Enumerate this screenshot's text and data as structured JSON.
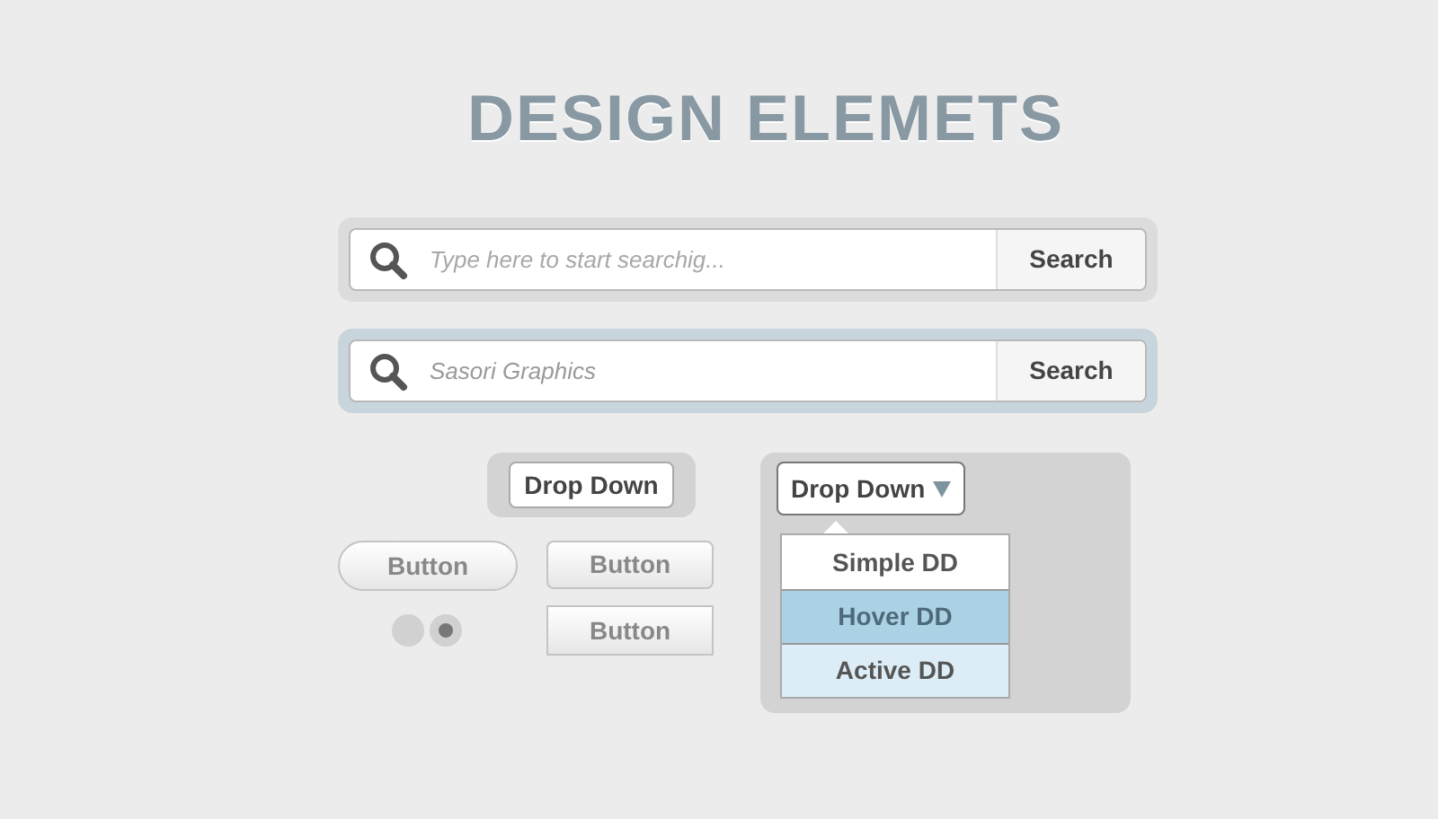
{
  "title": "DESIGN ELEMETS",
  "search_bars": [
    {
      "focused": false,
      "placeholder": "Type here to start searchig...",
      "button": "Search"
    },
    {
      "focused": true,
      "value": "Sasori Graphics",
      "button": "Search"
    }
  ],
  "dropdown_button": {
    "label": "Drop Down"
  },
  "buttons": [
    {
      "kind": "pill",
      "label": "Button"
    },
    {
      "kind": "rounded",
      "label": "Button"
    },
    {
      "kind": "square",
      "label": "Button"
    }
  ],
  "radios": [
    {
      "selected": false
    },
    {
      "selected": true
    }
  ],
  "dropdown_menu": {
    "label": "Drop Down",
    "expanded": true,
    "items": [
      {
        "kind": "simple",
        "label": "Simple DD"
      },
      {
        "kind": "hover",
        "label": "Hover DD"
      },
      {
        "kind": "active",
        "label": "Active DD"
      }
    ]
  }
}
